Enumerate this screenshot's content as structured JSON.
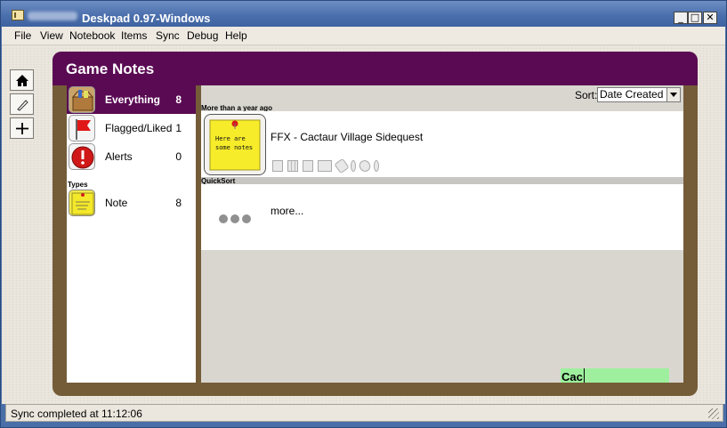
{
  "window": {
    "title": "Deskpad 0.97-Windows",
    "controls": {
      "minimize": "_",
      "maximize": "□",
      "close": "✕"
    }
  },
  "menu": [
    "File",
    "View",
    "Notebook",
    "Items",
    "Sync",
    "Debug",
    "Help"
  ],
  "toolbar": [
    {
      "name": "home-icon"
    },
    {
      "name": "edit-icon"
    },
    {
      "name": "add-icon"
    }
  ],
  "notebook": {
    "title": "Game Notes"
  },
  "sidebar": {
    "items": [
      {
        "label": "Everything",
        "count": "8",
        "icon": "box-icon"
      },
      {
        "label": "Flagged/Liked",
        "count": "1",
        "icon": "flag-icon"
      },
      {
        "label": "Alerts",
        "count": "0",
        "icon": "alert-icon"
      }
    ],
    "types_label": "Types",
    "types": [
      {
        "label": "Note",
        "count": "8",
        "icon": "sticky-note-icon",
        "note_text": "Here are some notes"
      }
    ]
  },
  "main": {
    "sort_label": "Sort:",
    "sort_value": "Date Created",
    "groups": [
      {
        "label": "More than a year ago",
        "items": [
          {
            "title": "FFX - Cactaur Village Sidequest",
            "thumb_text": "Here are some notes"
          }
        ]
      },
      {
        "label": "QuickSort",
        "more_label": "more..."
      }
    ],
    "cache_text": "Cac"
  },
  "status": {
    "text": "Sync completed at 11:12:06"
  },
  "colors": {
    "accent": "#5a0a53",
    "frame": "#745c38",
    "highlight": "#9ef09e"
  }
}
